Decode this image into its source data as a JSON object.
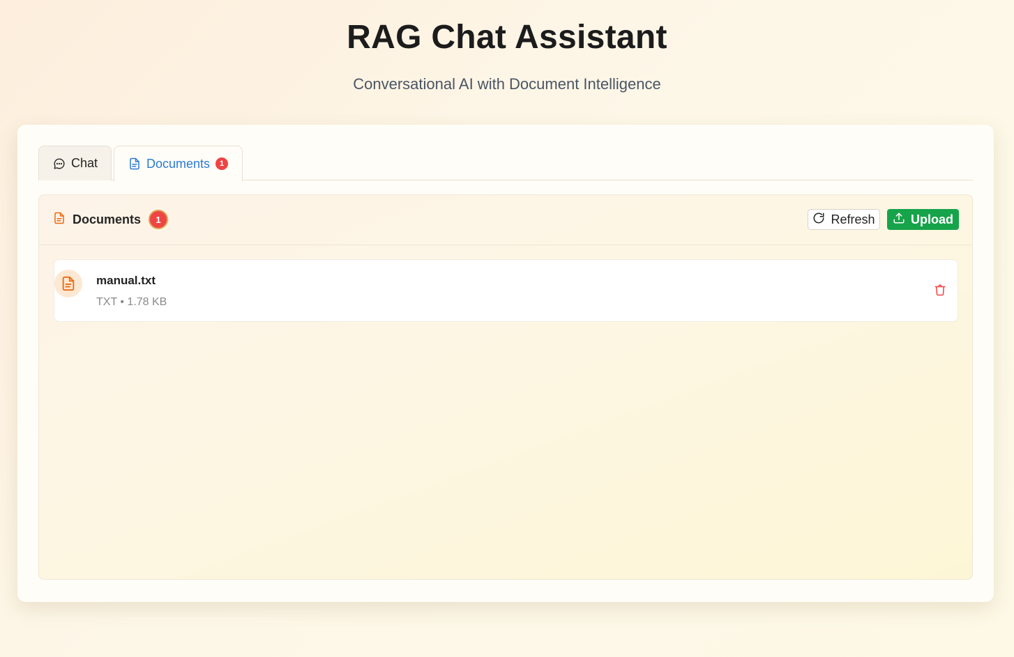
{
  "header": {
    "title": "RAG Chat Assistant",
    "subtitle": "Conversational AI with Document Intelligence"
  },
  "tabs": [
    {
      "label": "Chat",
      "icon": "chat-bubble-icon",
      "active": false
    },
    {
      "label": "Documents",
      "icon": "document-icon",
      "active": true,
      "badge": "1"
    }
  ],
  "documents_panel": {
    "title": "Documents",
    "count": "1",
    "refresh_label": "Refresh",
    "upload_label": "Upload",
    "items": [
      {
        "name": "manual.txt",
        "meta": "TXT • 1.78 KB",
        "icon": "document-icon"
      }
    ]
  },
  "colors": {
    "accent_blue": "#2b7ad6",
    "badge_red": "#ef4444",
    "upload_green": "#16a34a",
    "doc_orange": "#ea6a12"
  }
}
